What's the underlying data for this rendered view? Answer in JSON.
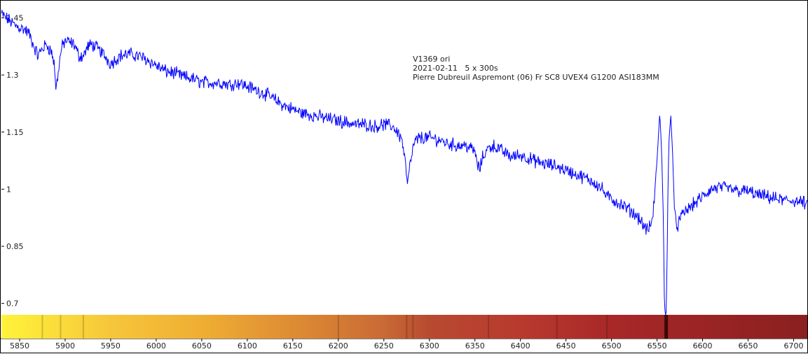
{
  "chart_data": {
    "type": "line",
    "title": "",
    "xlabel": "",
    "ylabel": "",
    "xlim": [
      5830,
      6715
    ],
    "ylim": [
      0.67,
      1.495
    ],
    "x_ticks": [
      5850,
      5900,
      5950,
      6000,
      6050,
      6100,
      6150,
      6200,
      6250,
      6300,
      6350,
      6400,
      6450,
      6500,
      6550,
      6600,
      6650,
      6700
    ],
    "y_ticks": [
      0.7,
      0.85,
      1,
      1.15,
      1.3,
      1.45
    ],
    "y_tick_labels": [
      "0.7",
      "0.85",
      "1",
      "1.15",
      "1.3",
      "1.45"
    ],
    "grid": false,
    "legend": "none",
    "line_color": "#0000ff",
    "annotations": [
      "V1369 ori",
      "2021-02-11   5 x 300s",
      "Pierre Dubreuil Aspremont (06) Fr SC8 UVEX4 G1200 ASI183MM"
    ],
    "colorbar_stops": [
      {
        "x": 5830,
        "color": "#fff33a"
      },
      {
        "x": 5950,
        "color": "#f6c63a"
      },
      {
        "x": 6050,
        "color": "#efae33"
      },
      {
        "x": 6150,
        "color": "#de8c34"
      },
      {
        "x": 6250,
        "color": "#c96a35"
      },
      {
        "x": 6300,
        "color": "#b84a30"
      },
      {
        "x": 6400,
        "color": "#b83a2e"
      },
      {
        "x": 6500,
        "color": "#a82828"
      },
      {
        "x": 6600,
        "color": "#9b2424"
      },
      {
        "x": 6715,
        "color": "#8a2020"
      }
    ],
    "colorbar_lines": [
      5875,
      5895,
      5920,
      6200,
      6275,
      6282,
      6365,
      6440,
      6495,
      6560
    ],
    "series": [
      {
        "name": "",
        "x": [
          5830,
          5835,
          5840,
          5845,
          5850,
          5855,
          5860,
          5865,
          5870,
          5875,
          5880,
          5885,
          5888,
          5890,
          5893,
          5896,
          5900,
          5905,
          5910,
          5915,
          5920,
          5925,
          5930,
          5935,
          5940,
          5945,
          5950,
          5955,
          5960,
          5970,
          5980,
          5990,
          6000,
          6010,
          6020,
          6030,
          6040,
          6050,
          6060,
          6070,
          6080,
          6090,
          6100,
          6110,
          6120,
          6130,
          6140,
          6150,
          6160,
          6170,
          6180,
          6190,
          6200,
          6210,
          6220,
          6230,
          6240,
          6250,
          6260,
          6265,
          6270,
          6274,
          6276,
          6278,
          6282,
          6286,
          6290,
          6300,
          6310,
          6320,
          6330,
          6340,
          6350,
          6352,
          6355,
          6358,
          6362,
          6366,
          6370,
          6380,
          6390,
          6400,
          6410,
          6420,
          6430,
          6440,
          6450,
          6460,
          6470,
          6480,
          6490,
          6495,
          6500,
          6510,
          6520,
          6530,
          6535,
          6540,
          6545,
          6548,
          6551,
          6553,
          6555,
          6557,
          6558,
          6559,
          6560,
          6561,
          6562,
          6563,
          6565,
          6567,
          6569,
          6572,
          6575,
          6580,
          6590,
          6600,
          6610,
          6620,
          6630,
          6640,
          6650,
          6660,
          6670,
          6680,
          6690,
          6700,
          6710,
          6715
        ],
        "y": [
          1.46,
          1.45,
          1.44,
          1.43,
          1.425,
          1.42,
          1.41,
          1.38,
          1.35,
          1.37,
          1.38,
          1.36,
          1.33,
          1.26,
          1.32,
          1.37,
          1.39,
          1.385,
          1.38,
          1.35,
          1.35,
          1.375,
          1.38,
          1.37,
          1.36,
          1.345,
          1.33,
          1.34,
          1.35,
          1.355,
          1.35,
          1.34,
          1.325,
          1.31,
          1.305,
          1.295,
          1.29,
          1.28,
          1.28,
          1.28,
          1.275,
          1.28,
          1.27,
          1.26,
          1.25,
          1.235,
          1.22,
          1.21,
          1.2,
          1.195,
          1.19,
          1.185,
          1.18,
          1.175,
          1.17,
          1.17,
          1.165,
          1.17,
          1.165,
          1.15,
          1.13,
          1.06,
          1.01,
          1.05,
          1.11,
          1.13,
          1.135,
          1.135,
          1.13,
          1.12,
          1.115,
          1.115,
          1.1,
          1.07,
          1.05,
          1.08,
          1.1,
          1.11,
          1.115,
          1.1,
          1.085,
          1.09,
          1.08,
          1.07,
          1.065,
          1.06,
          1.05,
          1.04,
          1.03,
          1.02,
          1.0,
          0.98,
          0.975,
          0.96,
          0.945,
          0.925,
          0.905,
          0.89,
          0.92,
          1.0,
          1.12,
          1.2,
          1.1,
          0.92,
          0.72,
          0.66,
          0.68,
          0.8,
          1.0,
          1.12,
          1.2,
          1.1,
          0.95,
          0.9,
          0.92,
          0.94,
          0.96,
          0.98,
          1.0,
          1.005,
          1.0,
          0.995,
          0.995,
          0.985,
          0.98,
          0.975,
          0.97,
          0.97,
          0.965,
          0.96
        ]
      }
    ]
  }
}
